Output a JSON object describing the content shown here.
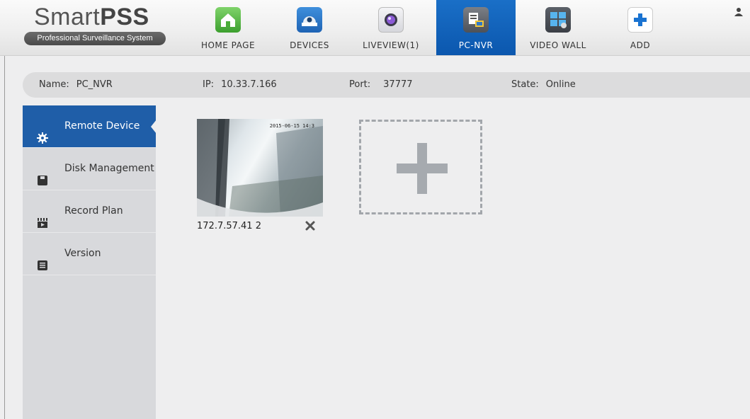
{
  "app": {
    "logo_light": "Smart",
    "logo_bold": "PSS",
    "subtitle": "Professional Surveillance System"
  },
  "nav": {
    "tabs": [
      {
        "label": "HOME PAGE",
        "icon": "home-icon"
      },
      {
        "label": "DEVICES",
        "icon": "camera-dome-icon"
      },
      {
        "label": "LIVEVIEW(1)",
        "icon": "lens-icon"
      },
      {
        "label": "PC-NVR",
        "icon": "pc-nvr-icon",
        "active": true
      },
      {
        "label": "VIDEO WALL",
        "icon": "video-wall-icon"
      },
      {
        "label": "ADD",
        "icon": "plus-icon"
      }
    ]
  },
  "info": {
    "name_label": "Name:",
    "name_value": "PC_NVR",
    "ip_label": "IP:",
    "ip_value": "10.33.7.166",
    "port_label": "Port:",
    "port_value": "37777",
    "state_label": "State:",
    "state_value": "Online"
  },
  "sidebar": {
    "items": [
      {
        "label": "Remote Device",
        "icon": "gear-icon",
        "active": true
      },
      {
        "label": "Disk Management",
        "icon": "disk-icon"
      },
      {
        "label": "Record Plan",
        "icon": "clapperboard-icon"
      },
      {
        "label": "Version",
        "icon": "list-icon"
      }
    ]
  },
  "devices": [
    {
      "name": "172.7.57.41 2",
      "timestamp": "2015-06-15 14:3"
    }
  ],
  "colors": {
    "accent": "#0b57ae",
    "sidebar_active": "#1f5ea8",
    "background": "#eeeeef"
  }
}
